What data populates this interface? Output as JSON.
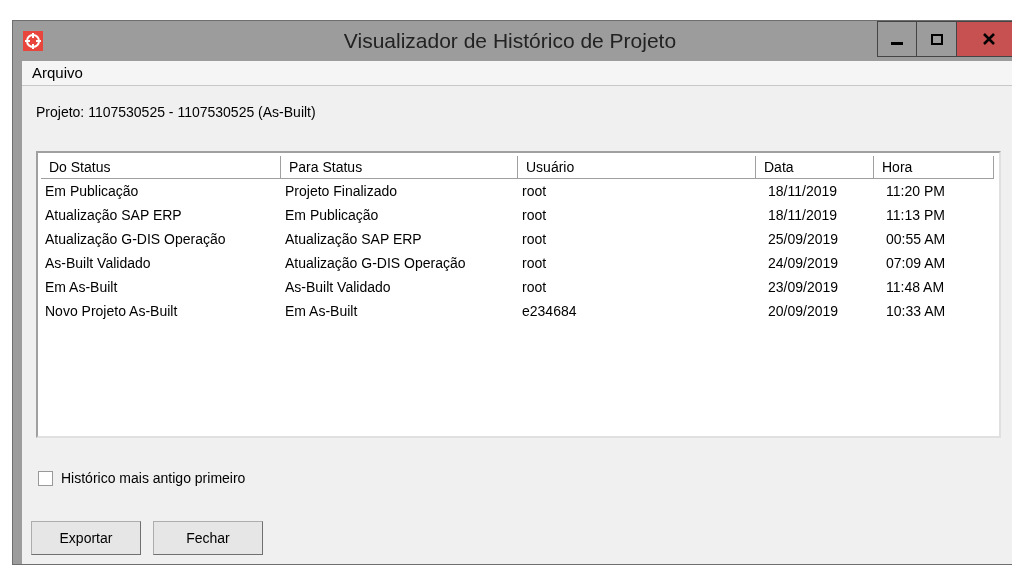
{
  "window": {
    "title": "Visualizador de Histórico de Projeto"
  },
  "menu": [
    "Arquivo"
  ],
  "project_label": "Projeto: 1107530525 - 1107530525 (As-Built)",
  "table": {
    "columns": [
      "Do Status",
      "Para Status",
      "Usuário",
      "Data",
      "Hora"
    ],
    "rows": [
      [
        "Em Publicação",
        "Projeto Finalizado",
        "root",
        "18/11/2019",
        "11:20 PM"
      ],
      [
        "Atualização SAP ERP",
        "Em Publicação",
        "root",
        "18/11/2019",
        "11:13 PM"
      ],
      [
        "Atualização G-DIS Operação",
        "Atualização SAP ERP",
        "root",
        "25/09/2019",
        "00:55 AM"
      ],
      [
        "As-Built Validado",
        "Atualização G-DIS Operação",
        "root",
        "24/09/2019",
        "07:09 AM"
      ],
      [
        "Em As-Built",
        "As-Built Validado",
        "root",
        "23/09/2019",
        "11:48 AM"
      ],
      [
        "Novo Projeto As-Built",
        "Em As-Built",
        "e234684",
        "20/09/2019",
        "10:33 AM"
      ]
    ]
  },
  "checkbox": {
    "label": "Histórico mais antigo primeiro",
    "checked": false
  },
  "buttons": [
    "Exportar",
    "Fechar"
  ]
}
